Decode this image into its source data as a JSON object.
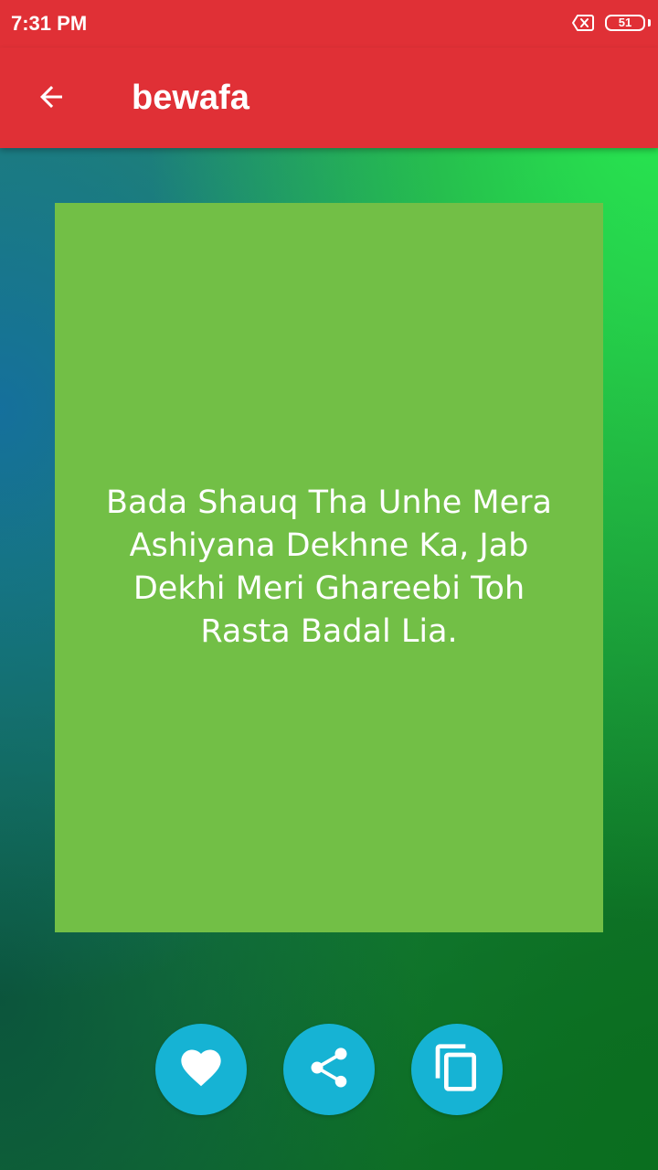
{
  "status_bar": {
    "time": "7:31 PM",
    "battery_level": "51",
    "icons": [
      "sim-error-icon",
      "battery-icon"
    ]
  },
  "app_bar": {
    "title": "bewafa",
    "back_icon": "arrow-left-icon"
  },
  "quote": {
    "text": "Bada Shauq Tha Unhe Mera Ashiyana Dekhne Ka, Jab Dekhi Meri Ghareebi Toh Rasta Badal Lia.",
    "card_color": "#72bf46"
  },
  "actions": [
    {
      "id": "favorite",
      "icon": "heart-icon"
    },
    {
      "id": "share",
      "icon": "share-icon"
    },
    {
      "id": "copy",
      "icon": "copy-icon"
    }
  ],
  "colors": {
    "primary": "#e03036",
    "accent": "#16b3d4",
    "text_on_primary": "#ffffff"
  }
}
